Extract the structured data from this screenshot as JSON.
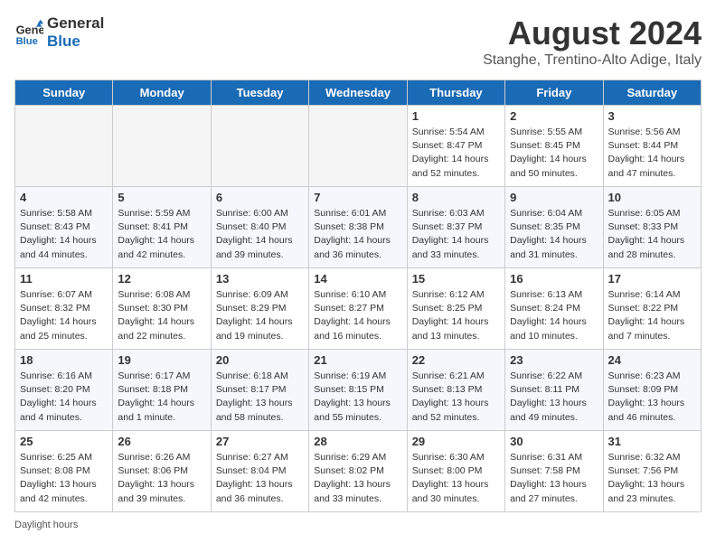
{
  "header": {
    "logo_line1": "General",
    "logo_line2": "Blue",
    "month": "August 2024",
    "location": "Stanghe, Trentino-Alto Adige, Italy"
  },
  "weekdays": [
    "Sunday",
    "Monday",
    "Tuesday",
    "Wednesday",
    "Thursday",
    "Friday",
    "Saturday"
  ],
  "weeks": [
    [
      {
        "day": "",
        "info": ""
      },
      {
        "day": "",
        "info": ""
      },
      {
        "day": "",
        "info": ""
      },
      {
        "day": "",
        "info": ""
      },
      {
        "day": "1",
        "info": "Sunrise: 5:54 AM\nSunset: 8:47 PM\nDaylight: 14 hours and 52 minutes."
      },
      {
        "day": "2",
        "info": "Sunrise: 5:55 AM\nSunset: 8:45 PM\nDaylight: 14 hours and 50 minutes."
      },
      {
        "day": "3",
        "info": "Sunrise: 5:56 AM\nSunset: 8:44 PM\nDaylight: 14 hours and 47 minutes."
      }
    ],
    [
      {
        "day": "4",
        "info": "Sunrise: 5:58 AM\nSunset: 8:43 PM\nDaylight: 14 hours and 44 minutes."
      },
      {
        "day": "5",
        "info": "Sunrise: 5:59 AM\nSunset: 8:41 PM\nDaylight: 14 hours and 42 minutes."
      },
      {
        "day": "6",
        "info": "Sunrise: 6:00 AM\nSunset: 8:40 PM\nDaylight: 14 hours and 39 minutes."
      },
      {
        "day": "7",
        "info": "Sunrise: 6:01 AM\nSunset: 8:38 PM\nDaylight: 14 hours and 36 minutes."
      },
      {
        "day": "8",
        "info": "Sunrise: 6:03 AM\nSunset: 8:37 PM\nDaylight: 14 hours and 33 minutes."
      },
      {
        "day": "9",
        "info": "Sunrise: 6:04 AM\nSunset: 8:35 PM\nDaylight: 14 hours and 31 minutes."
      },
      {
        "day": "10",
        "info": "Sunrise: 6:05 AM\nSunset: 8:33 PM\nDaylight: 14 hours and 28 minutes."
      }
    ],
    [
      {
        "day": "11",
        "info": "Sunrise: 6:07 AM\nSunset: 8:32 PM\nDaylight: 14 hours and 25 minutes."
      },
      {
        "day": "12",
        "info": "Sunrise: 6:08 AM\nSunset: 8:30 PM\nDaylight: 14 hours and 22 minutes."
      },
      {
        "day": "13",
        "info": "Sunrise: 6:09 AM\nSunset: 8:29 PM\nDaylight: 14 hours and 19 minutes."
      },
      {
        "day": "14",
        "info": "Sunrise: 6:10 AM\nSunset: 8:27 PM\nDaylight: 14 hours and 16 minutes."
      },
      {
        "day": "15",
        "info": "Sunrise: 6:12 AM\nSunset: 8:25 PM\nDaylight: 14 hours and 13 minutes."
      },
      {
        "day": "16",
        "info": "Sunrise: 6:13 AM\nSunset: 8:24 PM\nDaylight: 14 hours and 10 minutes."
      },
      {
        "day": "17",
        "info": "Sunrise: 6:14 AM\nSunset: 8:22 PM\nDaylight: 14 hours and 7 minutes."
      }
    ],
    [
      {
        "day": "18",
        "info": "Sunrise: 6:16 AM\nSunset: 8:20 PM\nDaylight: 14 hours and 4 minutes."
      },
      {
        "day": "19",
        "info": "Sunrise: 6:17 AM\nSunset: 8:18 PM\nDaylight: 14 hours and 1 minute."
      },
      {
        "day": "20",
        "info": "Sunrise: 6:18 AM\nSunset: 8:17 PM\nDaylight: 13 hours and 58 minutes."
      },
      {
        "day": "21",
        "info": "Sunrise: 6:19 AM\nSunset: 8:15 PM\nDaylight: 13 hours and 55 minutes."
      },
      {
        "day": "22",
        "info": "Sunrise: 6:21 AM\nSunset: 8:13 PM\nDaylight: 13 hours and 52 minutes."
      },
      {
        "day": "23",
        "info": "Sunrise: 6:22 AM\nSunset: 8:11 PM\nDaylight: 13 hours and 49 minutes."
      },
      {
        "day": "24",
        "info": "Sunrise: 6:23 AM\nSunset: 8:09 PM\nDaylight: 13 hours and 46 minutes."
      }
    ],
    [
      {
        "day": "25",
        "info": "Sunrise: 6:25 AM\nSunset: 8:08 PM\nDaylight: 13 hours and 42 minutes."
      },
      {
        "day": "26",
        "info": "Sunrise: 6:26 AM\nSunset: 8:06 PM\nDaylight: 13 hours and 39 minutes."
      },
      {
        "day": "27",
        "info": "Sunrise: 6:27 AM\nSunset: 8:04 PM\nDaylight: 13 hours and 36 minutes."
      },
      {
        "day": "28",
        "info": "Sunrise: 6:29 AM\nSunset: 8:02 PM\nDaylight: 13 hours and 33 minutes."
      },
      {
        "day": "29",
        "info": "Sunrise: 6:30 AM\nSunset: 8:00 PM\nDaylight: 13 hours and 30 minutes."
      },
      {
        "day": "30",
        "info": "Sunrise: 6:31 AM\nSunset: 7:58 PM\nDaylight: 13 hours and 27 minutes."
      },
      {
        "day": "31",
        "info": "Sunrise: 6:32 AM\nSunset: 7:56 PM\nDaylight: 13 hours and 23 minutes."
      }
    ]
  ],
  "footer": "Daylight hours"
}
